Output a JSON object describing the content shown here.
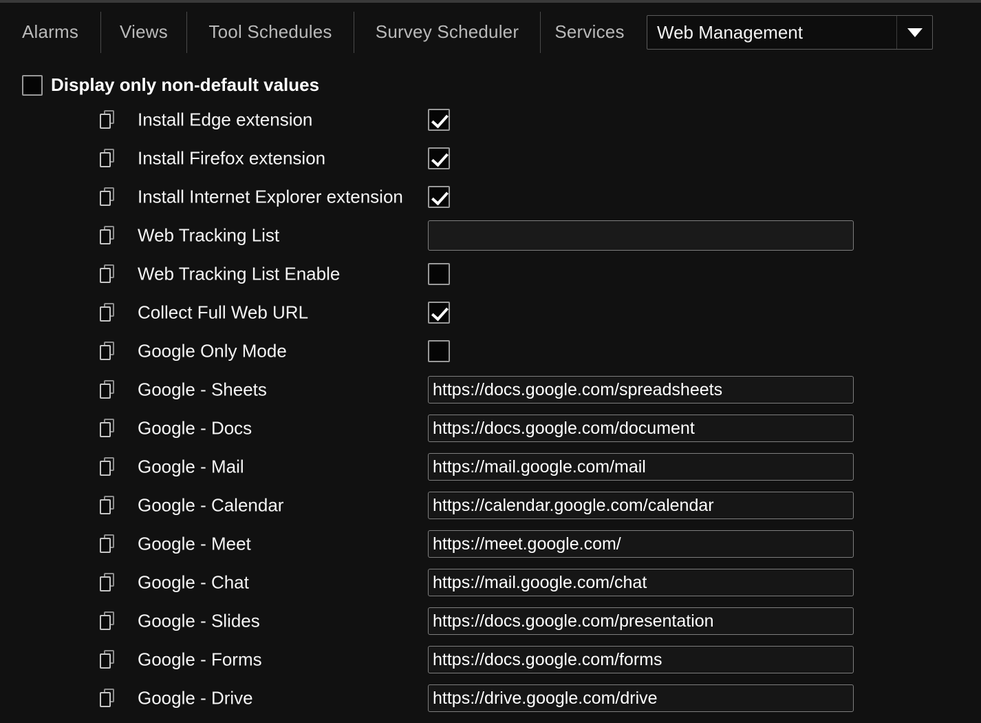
{
  "window": {
    "accent_color": "#ffffff",
    "background_color": "#111111",
    "border_color": "#7e7e7e"
  },
  "tabs": [
    {
      "label": "Alarms",
      "selected": false
    },
    {
      "label": "Views",
      "selected": false
    },
    {
      "label": "Tool Schedules",
      "selected": false
    },
    {
      "label": "Survey Scheduler",
      "selected": false
    },
    {
      "label": "Services",
      "selected": false
    }
  ],
  "section_selector": {
    "value": "Web Management",
    "icon": "chevron-down-icon"
  },
  "filter": {
    "label": "Display only non-default values",
    "checked": false
  },
  "settings": [
    {
      "icon": "copy-icon",
      "label": "Install Edge extension",
      "type": "checkbox",
      "checked": true,
      "value": ""
    },
    {
      "icon": "copy-icon",
      "label": "Install Firefox extension",
      "type": "checkbox",
      "checked": true,
      "value": ""
    },
    {
      "icon": "copy-icon",
      "label": "Install Internet Explorer extension",
      "type": "checkbox",
      "checked": true,
      "value": ""
    },
    {
      "icon": "copy-icon",
      "label": "Web Tracking List",
      "type": "text-tall",
      "checked": false,
      "value": ""
    },
    {
      "icon": "copy-icon",
      "label": "Web Tracking List Enable",
      "type": "checkbox",
      "checked": false,
      "value": ""
    },
    {
      "icon": "copy-icon",
      "label": "Collect Full Web URL",
      "type": "checkbox",
      "checked": true,
      "value": ""
    },
    {
      "icon": "copy-icon",
      "label": "Google Only Mode",
      "type": "checkbox",
      "checked": false,
      "value": ""
    },
    {
      "icon": "copy-icon",
      "label": "Google - Sheets",
      "type": "text",
      "checked": false,
      "value": "https://docs.google.com/spreadsheets"
    },
    {
      "icon": "copy-icon",
      "label": "Google - Docs",
      "type": "text",
      "checked": false,
      "value": "https://docs.google.com/document"
    },
    {
      "icon": "copy-icon",
      "label": "Google - Mail",
      "type": "text",
      "checked": false,
      "value": "https://mail.google.com/mail"
    },
    {
      "icon": "copy-icon",
      "label": "Google - Calendar",
      "type": "text",
      "checked": false,
      "value": "https://calendar.google.com/calendar"
    },
    {
      "icon": "copy-icon",
      "label": "Google - Meet",
      "type": "text",
      "checked": false,
      "value": "https://meet.google.com/"
    },
    {
      "icon": "copy-icon",
      "label": "Google - Chat",
      "type": "text",
      "checked": false,
      "value": "https://mail.google.com/chat"
    },
    {
      "icon": "copy-icon",
      "label": "Google - Slides",
      "type": "text",
      "checked": false,
      "value": "https://docs.google.com/presentation"
    },
    {
      "icon": "copy-icon",
      "label": "Google - Forms",
      "type": "text",
      "checked": false,
      "value": "https://docs.google.com/forms"
    },
    {
      "icon": "copy-icon",
      "label": "Google - Drive",
      "type": "text",
      "checked": false,
      "value": "https://drive.google.com/drive"
    }
  ]
}
